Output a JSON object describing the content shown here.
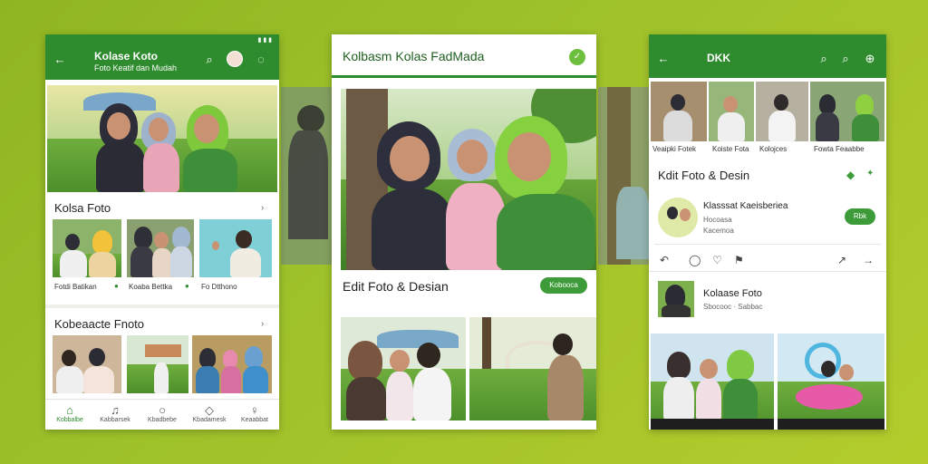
{
  "left_phone": {
    "title": "Kolase Koto",
    "subtitle": "Foto Keatif dan Mudah",
    "section1_title": "Kolsa Foto",
    "captions": [
      "Fotdi Batikan",
      "Koaba Bettka",
      "Fo Dtthono"
    ],
    "section2_title": "Kobeaacte Fnoto",
    "nav": [
      "Kobbalbe",
      "Kabbarsek",
      "Kbadbebe",
      "Kbadamesk",
      "Keaabbat"
    ]
  },
  "center_phone": {
    "title": "Kolbasm Kolas FadMada",
    "edit_title": "Edit Foto & Desian",
    "edit_button": "Kobooca"
  },
  "right_phone": {
    "title": "DKK",
    "top_captions": [
      "Veaipki Fotek",
      "Koiste Fota",
      "Kolojces",
      "Fowta Feaabbe"
    ],
    "edit_title": "Kdit Foto & Desin",
    "album_title": "Klasssat Kaeisberiea",
    "album_meta1": "Hocoasa",
    "album_meta2": "Kacemoa",
    "album_button": "Rbk",
    "user_title": "Kolaase Foto",
    "user_meta": "Sbocooc · Sabbac"
  },
  "colors": {
    "accent": "#2e8b2e",
    "background": "#9dc12a"
  }
}
